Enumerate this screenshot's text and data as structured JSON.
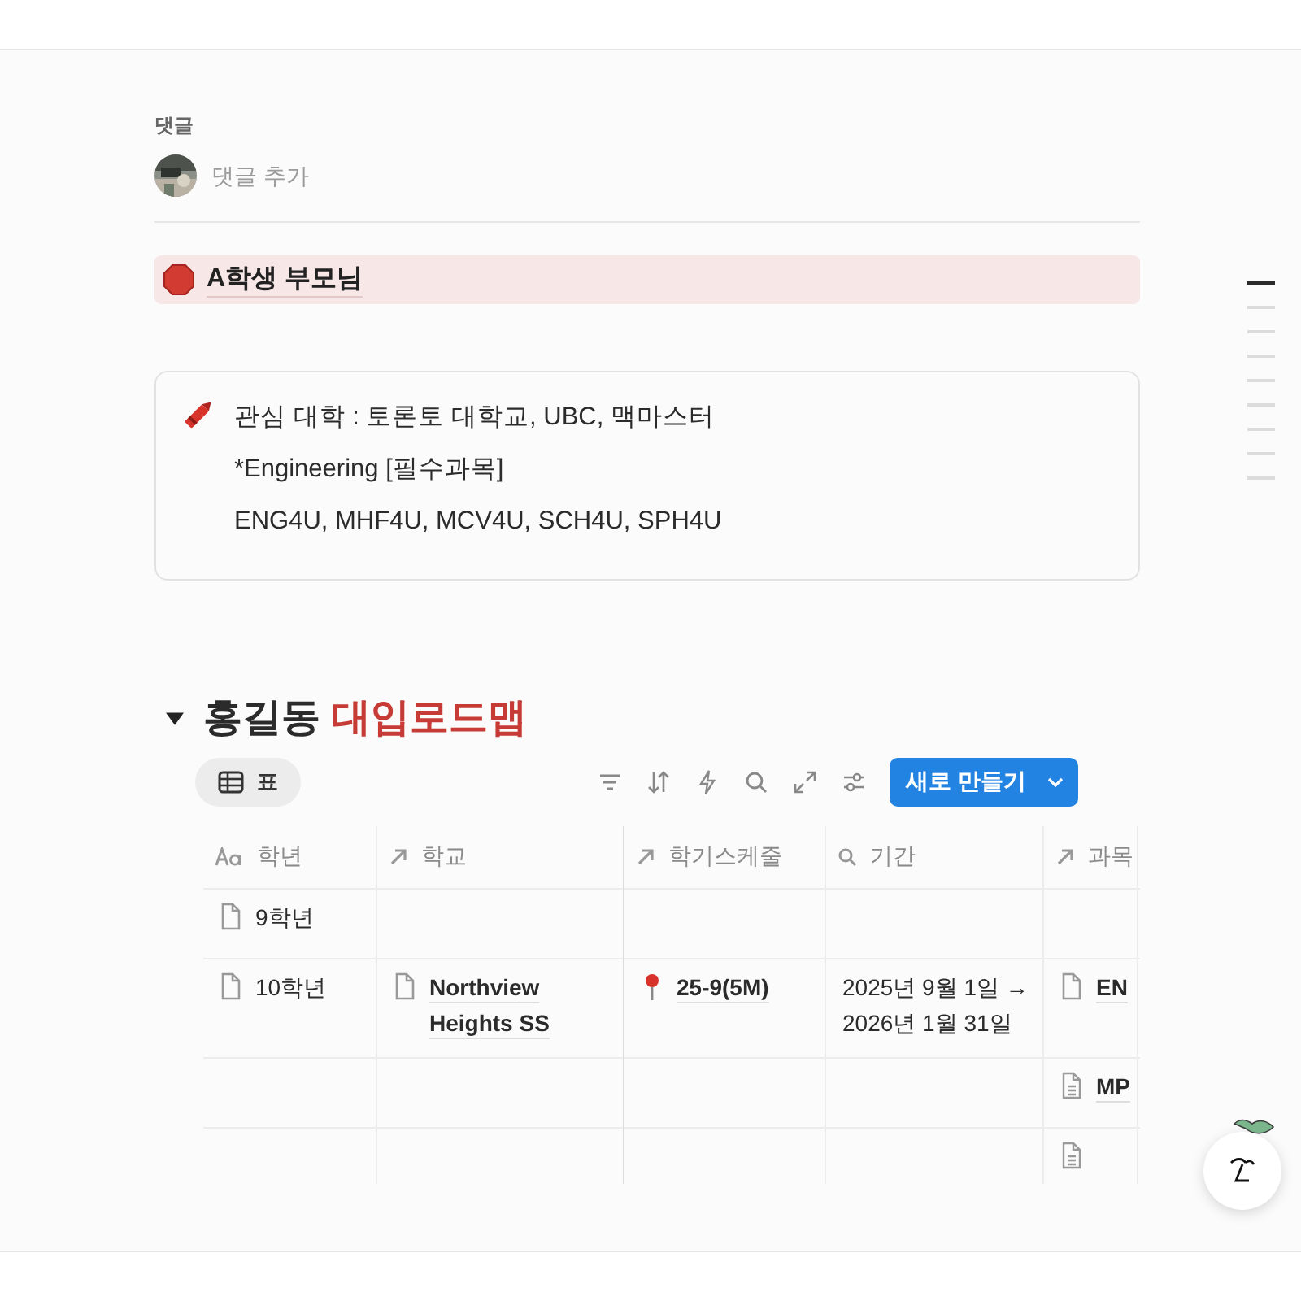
{
  "comments": {
    "label": "댓글",
    "placeholder": "댓글 추가"
  },
  "alert_callout": {
    "text": "A학생 부모님"
  },
  "note_callout": {
    "lines": [
      "관심 대학 : 토론토 대학교, UBC, 맥마스터",
      "*Engineering [필수과목]",
      "ENG4U, MHF4U, MCV4U, SCH4U, SPH4U"
    ]
  },
  "section": {
    "expanded": true,
    "title": "홍길동",
    "accent": "대입로드맵"
  },
  "views": [
    {
      "label": "표",
      "selected": true
    }
  ],
  "new_button": {
    "label": "새로 만들기"
  },
  "table": {
    "columns": [
      {
        "label": "학년",
        "kind": "title"
      },
      {
        "label": "학교",
        "kind": "relation"
      },
      {
        "label": "학기스케줄",
        "kind": "relation"
      },
      {
        "label": "기간",
        "kind": "search"
      },
      {
        "label": "과목",
        "kind": "relation"
      }
    ],
    "rows": [
      {
        "cells": [
          {
            "text": "9학년",
            "kind": "page"
          },
          null,
          null,
          null,
          null
        ]
      },
      {
        "cells": [
          {
            "text": "10학년",
            "kind": "page"
          },
          {
            "text": "Northview Heights SS",
            "kind": "page",
            "link": true
          },
          {
            "text": "25-9(5M)",
            "kind": "pin",
            "link": true
          },
          {
            "text": "2025년 9월 1일 → 2026년 1월 31일",
            "kind": "plain"
          },
          {
            "text": "EN",
            "kind": "page",
            "link": true
          }
        ]
      },
      {
        "cells": [
          null,
          null,
          null,
          null,
          {
            "text": "MP",
            "kind": "doc",
            "link": true
          }
        ]
      },
      {
        "cells": [
          null,
          null,
          null,
          null,
          {
            "kind": "doc"
          }
        ]
      }
    ]
  },
  "outline": [
    {
      "selected": true
    },
    {
      "selected": false
    },
    {
      "selected": false
    },
    {
      "selected": false
    },
    {
      "selected": false
    },
    {
      "selected": false
    },
    {
      "selected": false
    },
    {
      "selected": false
    },
    {
      "selected": false
    }
  ]
}
